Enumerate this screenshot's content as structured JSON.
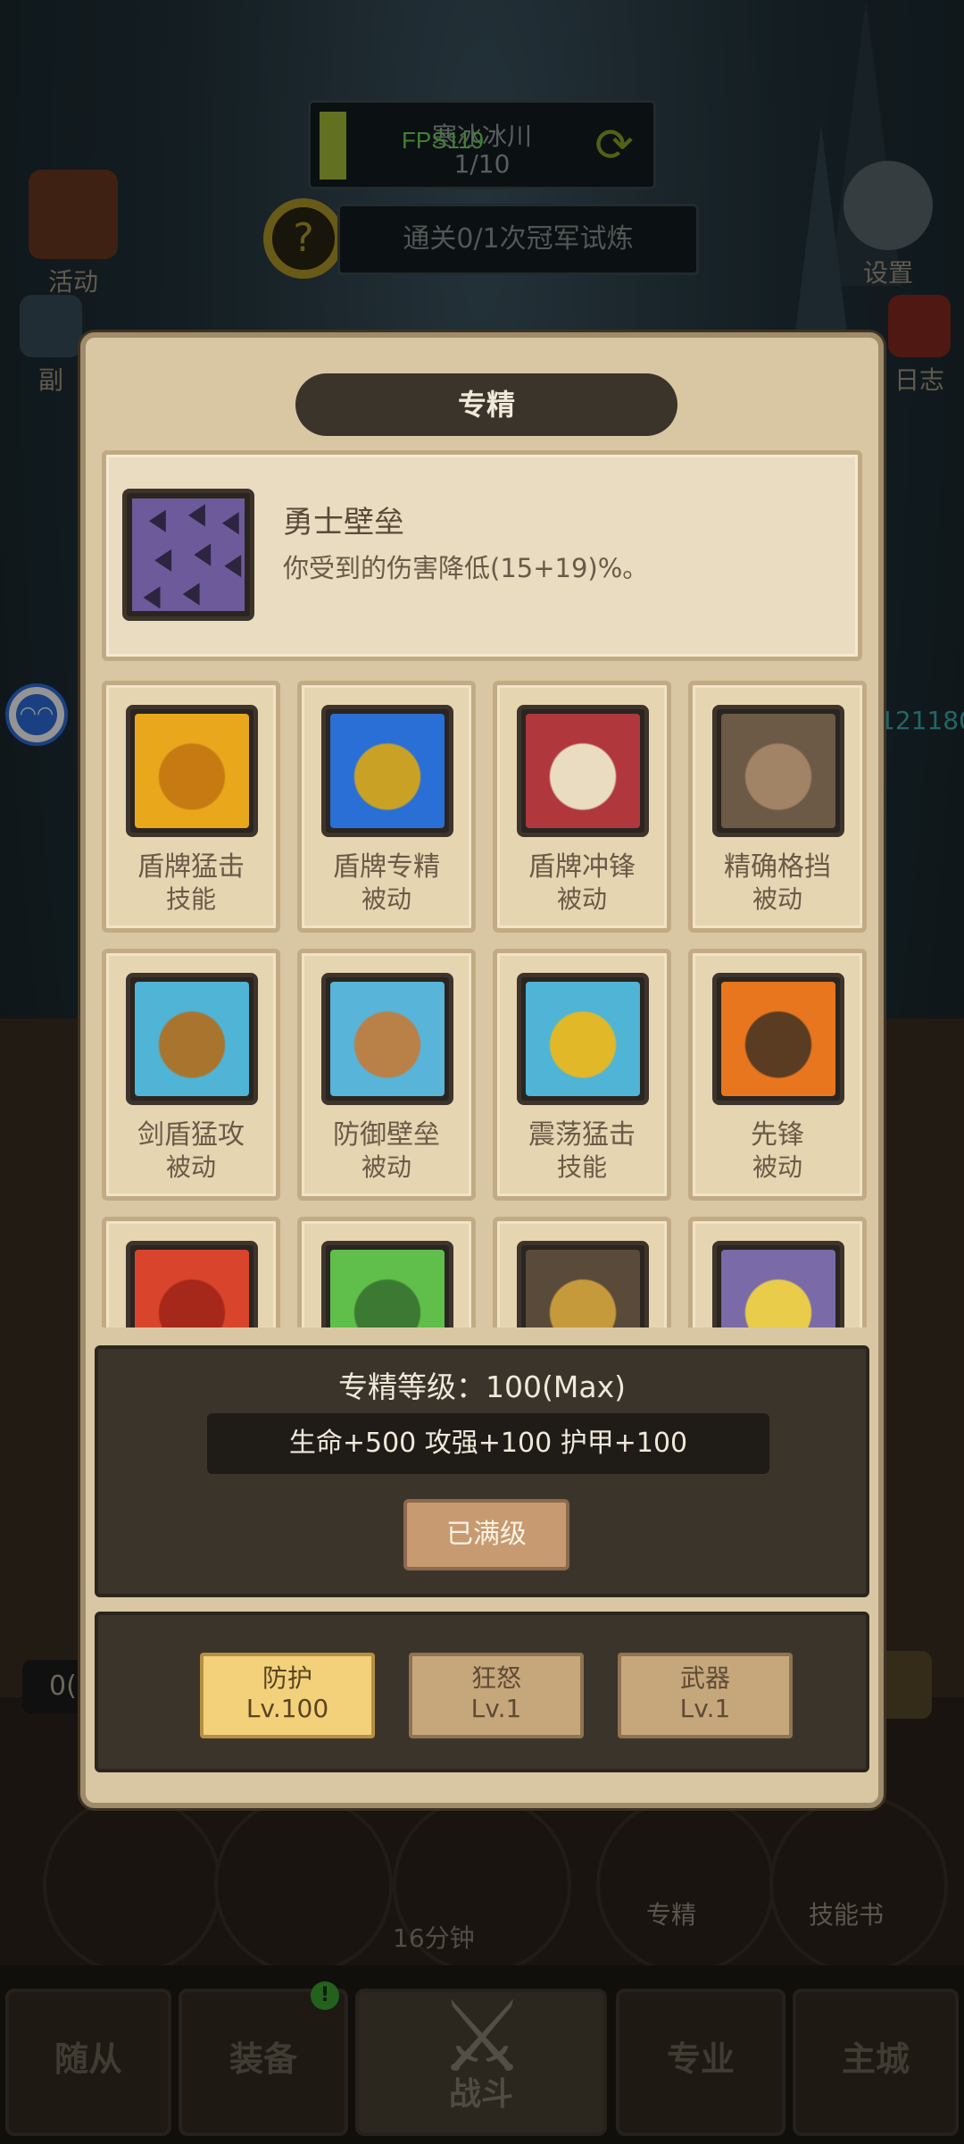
{
  "hud": {
    "stage_name": "寒冰冰川",
    "stage_progress": "1/10",
    "fps": "FPS119",
    "trial_text": "通关0/1次冠军试炼",
    "side_left": [
      "活动",
      "副"
    ],
    "side_right": [
      "设置",
      "日志"
    ],
    "right_number": "121180",
    "bottom_left_text": "0("
  },
  "modal": {
    "title": "专精",
    "selected": {
      "name": "勇士壁垒",
      "description": "你受到的伤害降低(15+19)%。",
      "icon": "spiked-armor-icon"
    },
    "skills": [
      {
        "name": "盾牌猛击",
        "type": "技能",
        "icon": "shield-bash-icon",
        "bg": "#e9a81c",
        "fg": "#c87a12"
      },
      {
        "name": "盾牌专精",
        "type": "被动",
        "icon": "shield-mastery-icon",
        "bg": "#2a6fd6",
        "fg": "#c9a225"
      },
      {
        "name": "盾牌冲锋",
        "type": "被动",
        "icon": "shield-charge-icon",
        "bg": "#b0383d",
        "fg": "#e9dcc0"
      },
      {
        "name": "精确格挡",
        "type": "被动",
        "icon": "precise-block-icon",
        "bg": "#6c5a46",
        "fg": "#a18365"
      },
      {
        "name": "剑盾猛攻",
        "type": "被动",
        "icon": "sword-shield-assault-icon",
        "bg": "#4fb4d6",
        "fg": "#a9742e"
      },
      {
        "name": "防御壁垒",
        "type": "被动",
        "icon": "defensive-bulwark-icon",
        "bg": "#58b4d9",
        "fg": "#b98148"
      },
      {
        "name": "震荡猛击",
        "type": "技能",
        "icon": "concussive-blow-icon",
        "bg": "#4fb4d6",
        "fg": "#e0b828"
      },
      {
        "name": "先锋",
        "type": "被动",
        "icon": "vanguard-fist-icon",
        "bg": "#e8761e",
        "fg": "#5a3c22"
      },
      {
        "name": "",
        "type": "",
        "icon": "berserker-armor-icon",
        "bg": "#d9452c",
        "fg": "#a6281a"
      },
      {
        "name": "",
        "type": "",
        "icon": "orc-face-icon",
        "bg": "#5fbf4a",
        "fg": "#3c7a34"
      },
      {
        "name": "",
        "type": "",
        "icon": "rune-shield-icon",
        "bg": "#5a4a3a",
        "fg": "#c59a3a"
      },
      {
        "name": "",
        "type": "",
        "icon": "golden-shield-icon",
        "bg": "#7a6aa8",
        "fg": "#e8cc4a"
      }
    ],
    "level_text": "专精等级：100(Max)",
    "bonus_text": "生命+500  攻强+100  护甲+100",
    "maxed_button": "已满级",
    "specs": [
      {
        "name": "防护",
        "level": "Lv.100",
        "active": true
      },
      {
        "name": "狂怒",
        "level": "Lv.1",
        "active": false
      },
      {
        "name": "武器",
        "level": "Lv.1",
        "active": false
      }
    ]
  },
  "menu": {
    "circle_labels": [
      "专精",
      "技能书"
    ],
    "timer": "16分钟",
    "tabs": [
      "随从",
      "装备",
      "战斗",
      "专业",
      "主城"
    ],
    "equip_badge": "!"
  },
  "colors": {
    "parchment": "#d9c7a3",
    "dark_panel": "#3b342b",
    "active_tab": "#f3d17b",
    "fps_green": "#6ee05a"
  }
}
